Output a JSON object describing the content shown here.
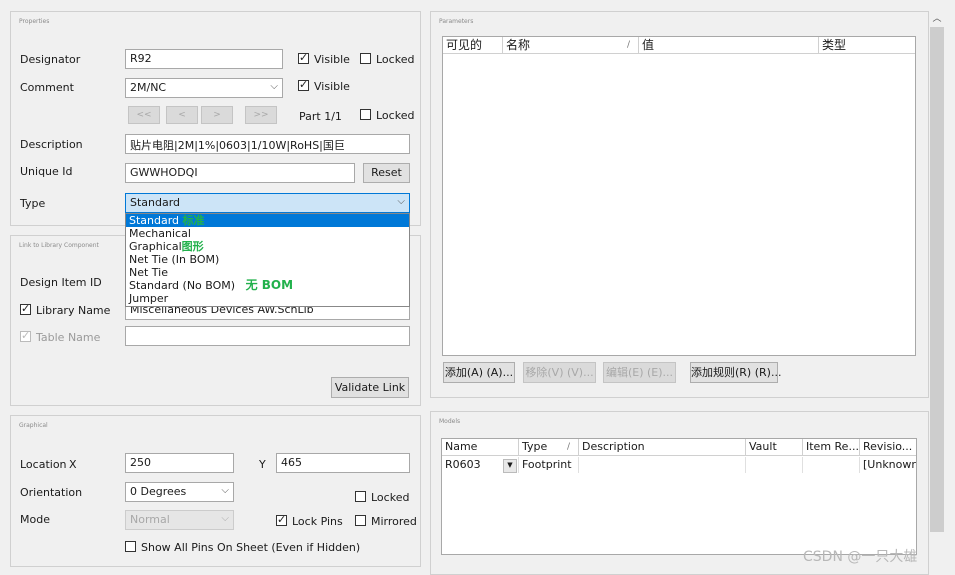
{
  "properties": {
    "title": "Properties",
    "designator_label": "Designator",
    "designator_value": "R92",
    "visible_label": "Visible",
    "locked_label": "Locked",
    "comment_label": "Comment",
    "comment_value": "2M/NC",
    "comment_visible_label": "Visible",
    "nav_first": "<<",
    "nav_prev": "<",
    "nav_next": ">",
    "nav_last": ">>",
    "part_label": "Part 1/1",
    "part_locked_label": "Locked",
    "description_label": "Description",
    "description_value": "贴片电阻|2M|1%|0603|1/10W|RoHS|国巨",
    "unique_id_label": "Unique Id",
    "unique_id_value": "GWWHODQI",
    "reset_label": "Reset",
    "type_label": "Type",
    "type_value": "Standard"
  },
  "type_dropdown": {
    "items": [
      {
        "label": "Standard",
        "note": "标准"
      },
      {
        "label": "Mechanical",
        "note": ""
      },
      {
        "label": "Graphical",
        "note": "图形"
      },
      {
        "label": "Net Tie (In BOM)",
        "note": ""
      },
      {
        "label": "Net Tie",
        "note": ""
      },
      {
        "label": "Standard (No BOM)",
        "note": "无 BOM"
      },
      {
        "label": "Jumper",
        "note": ""
      }
    ]
  },
  "library_link": {
    "title": "Link to Library Component",
    "design_item_label": "Design Item ID",
    "library_name_label": "Library Name",
    "library_name_value": "Miscellaneous Devices AW.SchLib",
    "table_name_label": "Table Name",
    "validate_label": "Validate Link"
  },
  "graphical": {
    "title": "Graphical",
    "location_label": "Location",
    "x_label": "X",
    "x_value": "250",
    "y_label": "Y",
    "y_value": "465",
    "orientation_label": "Orientation",
    "orientation_value": "0 Degrees",
    "locked_label": "Locked",
    "mode_label": "Mode",
    "mode_value": "Normal",
    "lock_pins_label": "Lock Pins",
    "mirrored_label": "Mirrored",
    "show_pins_label": "Show All Pins On Sheet (Even if Hidden)"
  },
  "parameters": {
    "title": "Parameters",
    "columns": [
      "可见的",
      "名称",
      "/",
      "值",
      "类型"
    ],
    "add_label": "添加(A) (A)...",
    "remove_label": "移除(V) (V)...",
    "edit_label": "编辑(E) (E)...",
    "add_rule_label": "添加规则(R) (R)..."
  },
  "models": {
    "title": "Models",
    "columns": [
      "Name",
      "Type",
      "/",
      "Description",
      "Vault",
      "Item Re...",
      "Revisio..."
    ],
    "rows": [
      {
        "name": "R0603",
        "type": "Footprint",
        "description": "",
        "vault": "",
        "item_rev": "",
        "revision": "[Unknowr"
      }
    ]
  },
  "watermark": "CSDN @一只大雄"
}
